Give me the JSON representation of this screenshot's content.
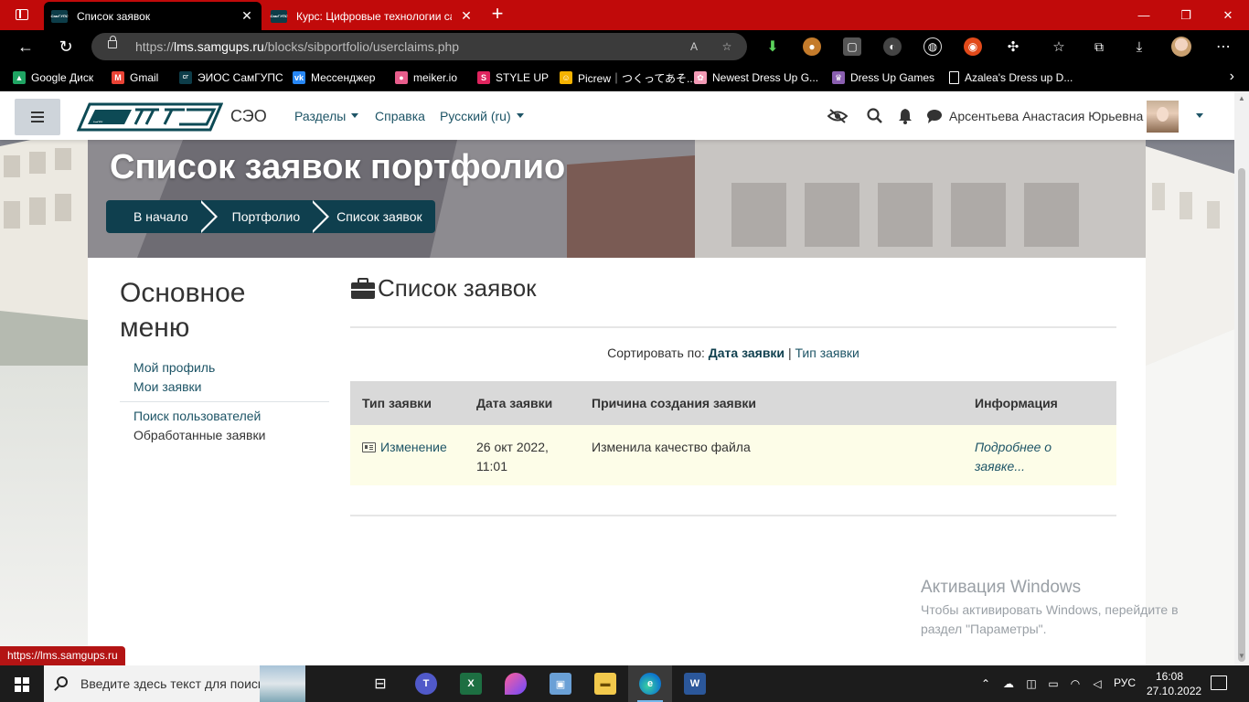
{
  "browser": {
    "tabs": [
      {
        "title": "Список заявок",
        "favicon": "СамГУПС"
      },
      {
        "title": "Курс: Цифровые технологии са",
        "favicon": "СамГУПС"
      }
    ],
    "url_prefix": "https://",
    "url_host": "lms.samgups.ru",
    "url_path": "/blocks/sibportfolio/userclaims.php",
    "bookmarks": [
      {
        "label": "Google Диск",
        "icon": "google-drive-icon",
        "color": "#1fa463"
      },
      {
        "label": "Gmail",
        "icon": "gmail-icon",
        "color": "#ea4335"
      },
      {
        "label": "ЭИОС СамГУПС",
        "icon": "samgups-icon",
        "color": "#0d3d49"
      },
      {
        "label": "Мессенджер",
        "icon": "vk-icon",
        "color": "#2787f5"
      },
      {
        "label": "meiker.io",
        "icon": "meiker-icon",
        "color": "#e85d8c"
      },
      {
        "label": "STYLE UP",
        "icon": "styleup-icon",
        "color": "#e0245e"
      },
      {
        "label": "Picrew｜つくってあそ...",
        "icon": "picrew-icon",
        "color": "#f5b301"
      },
      {
        "label": "Newest Dress Up G...",
        "icon": "dressup-icon",
        "color": "#f29ab5"
      },
      {
        "label": "Dress Up Games",
        "icon": "dressup-games-icon",
        "color": "#8a5fb0"
      },
      {
        "label": "Azalea's Dress up D...",
        "icon": "page-icon",
        "color": "#ffffff"
      }
    ],
    "status_url": "https://lms.samgups.ru"
  },
  "site": {
    "logo_text": "СамГУПС",
    "brand": "СЭО",
    "nav": {
      "sections": "Разделы",
      "help": "Справка",
      "language": "Русский (ru)"
    },
    "user_name": "Арсентьева Анастасия Юрьевна"
  },
  "hero": {
    "title": "Список заявок портфолио",
    "breadcrumbs": [
      "В начало",
      "Портфолио",
      "Список заявок"
    ]
  },
  "menu": {
    "title": "Основное меню",
    "links": [
      {
        "label": "Мой профиль"
      },
      {
        "label": "Мои заявки"
      },
      {
        "label": "Поиск пользователей"
      },
      {
        "label": "Обработанные заявки"
      }
    ]
  },
  "content": {
    "title": "Список заявок",
    "sort_prefix": "Сортировать по:",
    "sort_by_date": "Дата заявки",
    "sort_sep": "|",
    "sort_by_type": "Тип заявки",
    "table": {
      "headers": [
        "Тип заявки",
        "Дата заявки",
        "Причина создания заявки",
        "Информация"
      ],
      "rows": [
        {
          "type": "Изменение",
          "date_line1": "26 окт 2022,",
          "date_line2": "11:01",
          "reason": "Изменила качество файла",
          "info": "Подробнее о заявке..."
        }
      ]
    }
  },
  "activation": {
    "title": "Активация Windows",
    "text": "Чтобы активировать Windows, перейдите в раздел \"Параметры\"."
  },
  "taskbar": {
    "search_placeholder": "Введите здесь текст для поиска",
    "language": "РУС",
    "time": "16:08",
    "date": "27.10.2022"
  },
  "colors": {
    "browser_chrome": "#c10a0a",
    "brand_dark": "#0f3f4e",
    "link": "#1d5466",
    "row_highlight": "#fdfde8"
  }
}
